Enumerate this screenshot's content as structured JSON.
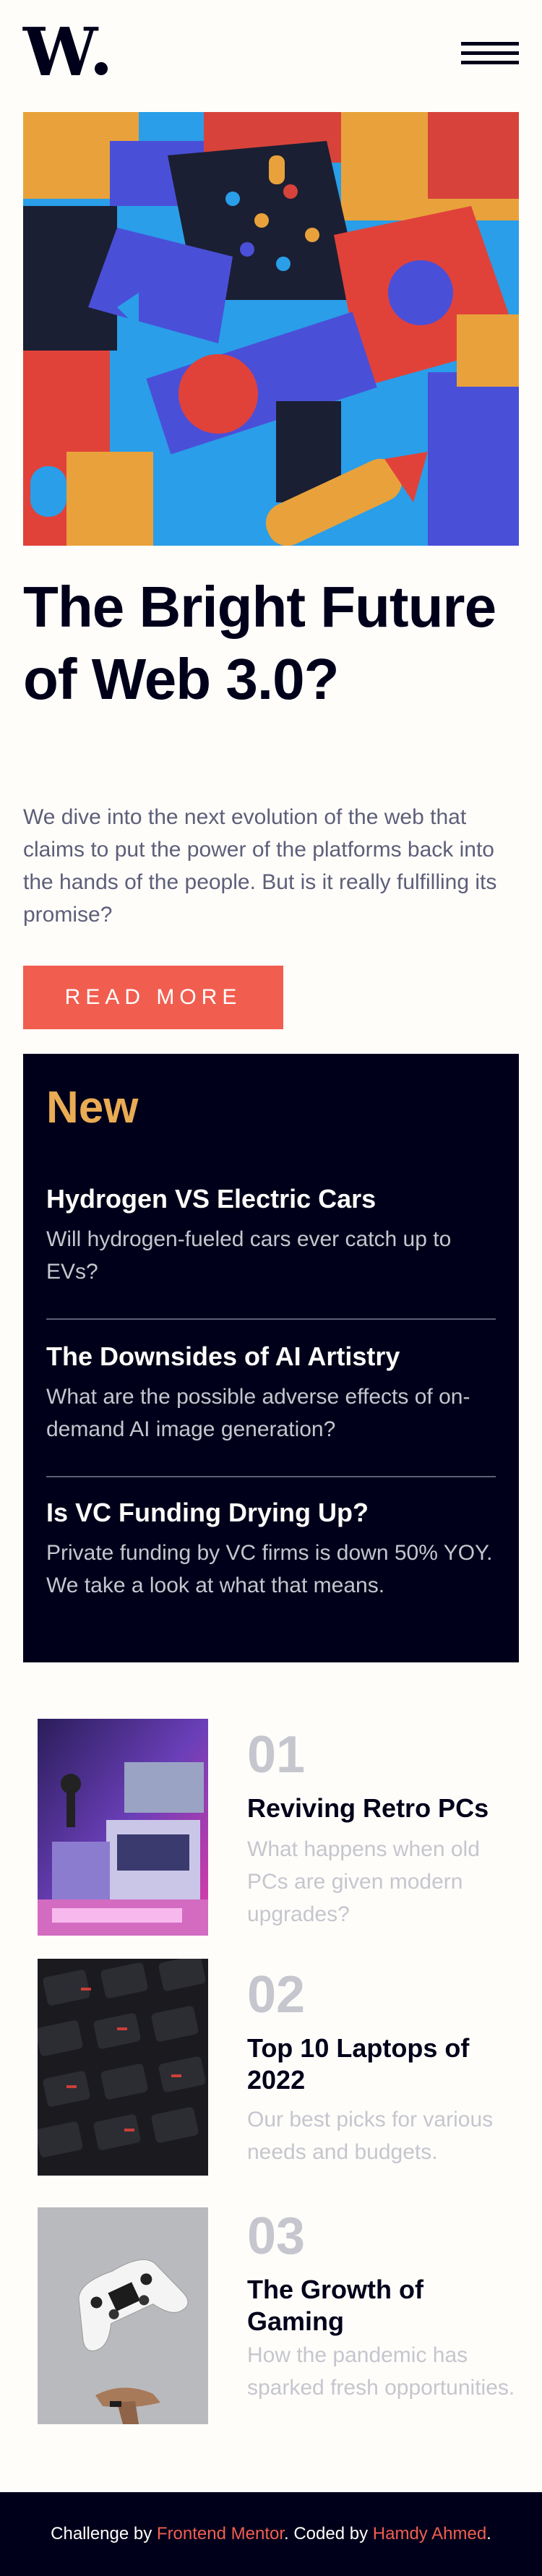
{
  "header": {
    "logo_text": "W",
    "menu_icon": "hamburger-menu-icon"
  },
  "hero": {
    "image_icon": "abstract-3d-blocks-illustration",
    "headline": "The Bright Future of Web 3.0?",
    "intro": "We dive into the next evolution of the web that claims to put the power of the platforms back into the hands of the people. But is it really fulfilling its promise?",
    "cta_label": "READ MORE"
  },
  "new": {
    "title": "New",
    "items": [
      {
        "title": "Hydrogen VS Electric Cars",
        "desc": "Will hydrogen-fueled cars ever catch up to EVs?"
      },
      {
        "title": "The Downsides of AI Artistry",
        "desc": "What are the possible adverse effects of on-demand AI image generation?"
      },
      {
        "title": "Is VC Funding Drying Up?",
        "desc": "Private funding by VC firms is down 50% YOY. We take a look at what that means."
      }
    ]
  },
  "top": {
    "items": [
      {
        "num": "01",
        "title": "Reviving Retro PCs",
        "desc": "What happens when old PCs are given modern upgrades?",
        "image_icon": "retro-pc-photo"
      },
      {
        "num": "02",
        "title": "Top 10 Laptops of 2022",
        "desc": "Our best picks for various needs and budgets.",
        "image_icon": "laptop-keyboard-photo"
      },
      {
        "num": "03",
        "title": "The Growth of Gaming",
        "desc": "How the pandemic has sparked fresh opportunities.",
        "image_icon": "game-controller-photo"
      }
    ]
  },
  "footer": {
    "prefix": "Challenge by ",
    "fm_link": "Frontend Mentor",
    "middle": ". Coded by ",
    "author_link": "Hamdy Ahmed",
    "suffix": "."
  },
  "colors": {
    "accent_red": "#f15e50",
    "accent_orange": "#e9ab53",
    "dark_navy": "#00001a",
    "off_white": "#fffdfa",
    "grayish_blue": "#5d5f79",
    "light_gray": "#c5c6ce"
  }
}
